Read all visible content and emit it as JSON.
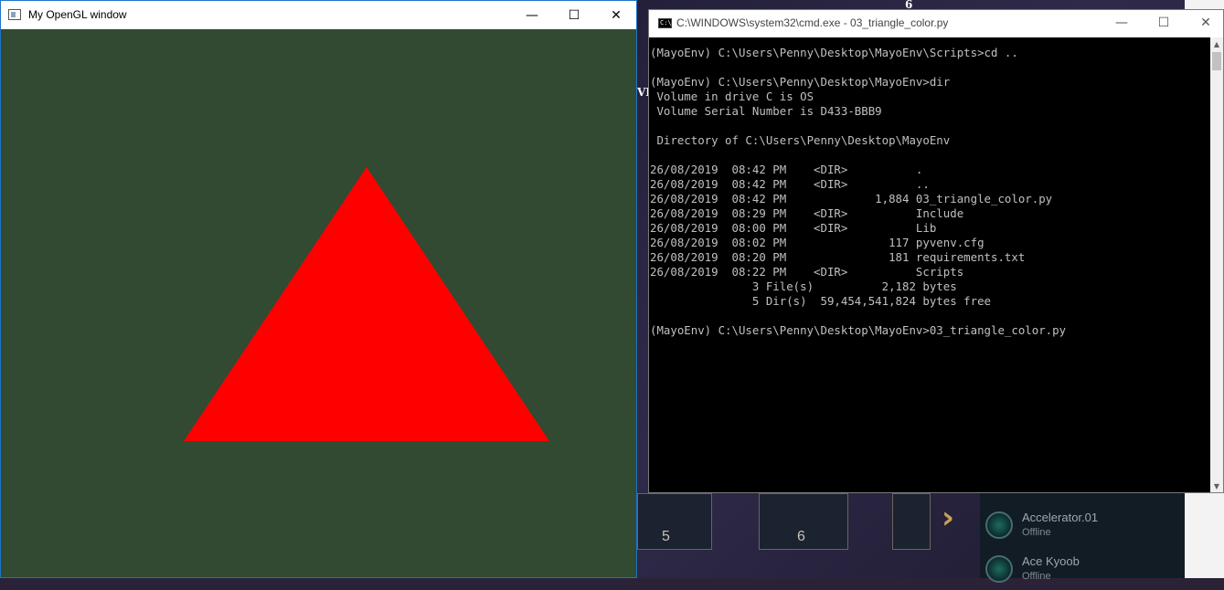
{
  "gl_window": {
    "title": "My OpenGL window",
    "minimize": "—",
    "maximize": "☐",
    "close": "✕",
    "clear_color": "#324a31",
    "triangle_color": "#ff0000"
  },
  "cmd_window": {
    "title": "C:\\WINDOWS\\system32\\cmd.exe - 03_triangle_color.py",
    "icon_text": "C:\\",
    "minimize": "—",
    "maximize": "☐",
    "close": "✕",
    "lines": [
      "(MayoEnv) C:\\Users\\Penny\\Desktop\\MayoEnv\\Scripts>cd ..",
      "",
      "(MayoEnv) C:\\Users\\Penny\\Desktop\\MayoEnv>dir",
      " Volume in drive C is OS",
      " Volume Serial Number is D433-BBB9",
      "",
      " Directory of C:\\Users\\Penny\\Desktop\\MayoEnv",
      "",
      "26/08/2019  08:42 PM    <DIR>          .",
      "26/08/2019  08:42 PM    <DIR>          ..",
      "26/08/2019  08:42 PM             1,884 03_triangle_color.py",
      "26/08/2019  08:29 PM    <DIR>          Include",
      "26/08/2019  08:00 PM    <DIR>          Lib",
      "26/08/2019  08:02 PM               117 pyvenv.cfg",
      "26/08/2019  08:20 PM               181 requirements.txt",
      "26/08/2019  08:22 PM    <DIR>          Scripts",
      "               3 File(s)          2,182 bytes",
      "               5 Dir(s)  59,454,541,824 bytes free",
      "",
      "(MayoEnv) C:\\Users\\Penny\\Desktop\\MayoEnv>03_triangle_color.py"
    ]
  },
  "background": {
    "top_count": "6",
    "side_glyph": "VI",
    "tile_numbers": [
      "5",
      "6"
    ],
    "next_arrow": "›",
    "friends": [
      {
        "name": "Accelerator.01",
        "status": "Offline"
      },
      {
        "name": "Ace Kyoob",
        "status": "Offline"
      }
    ]
  }
}
